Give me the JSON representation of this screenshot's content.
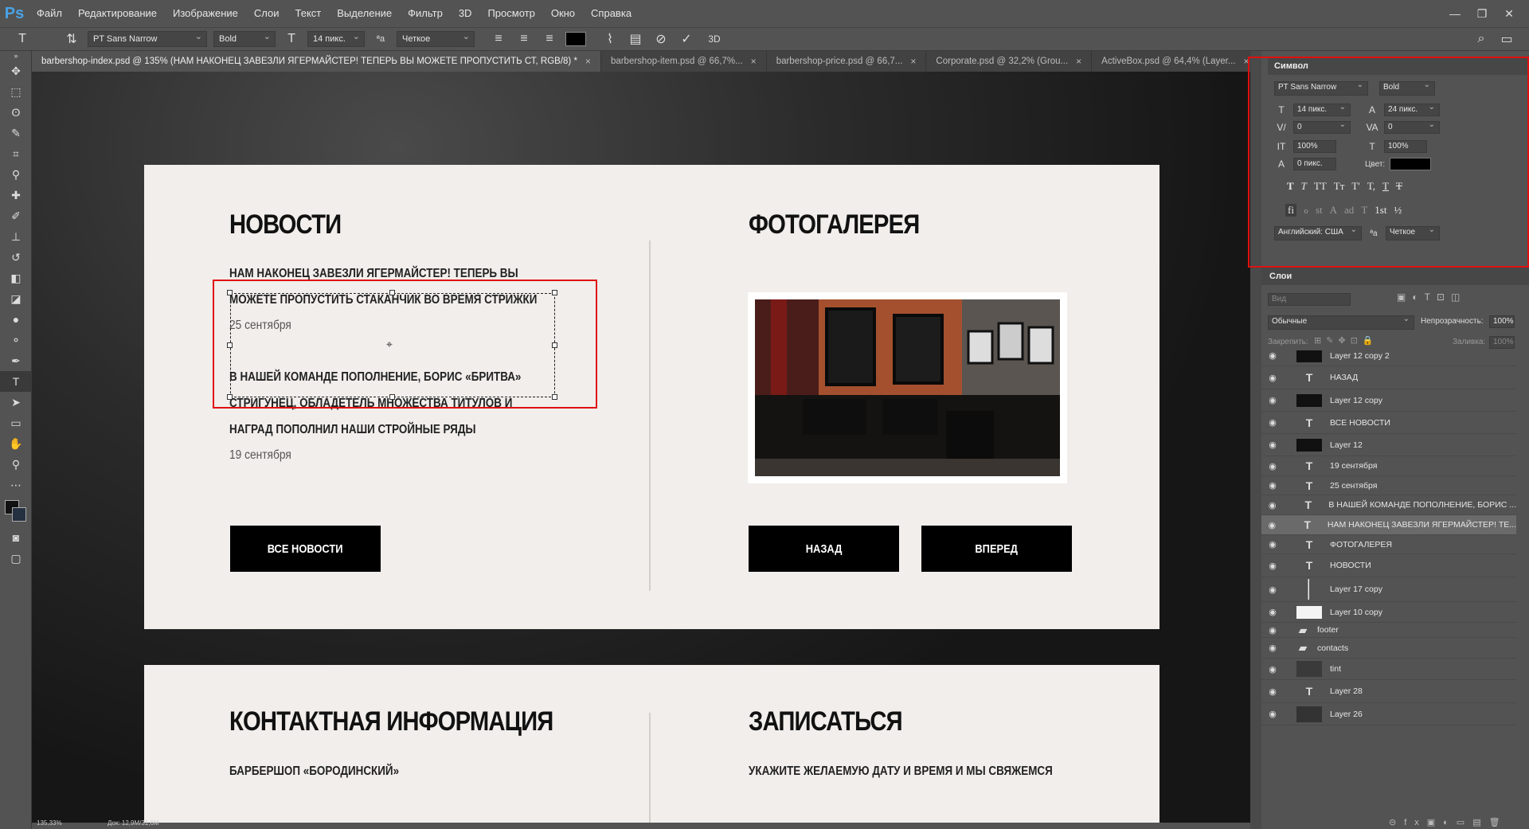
{
  "app": {
    "logo": "Ps"
  },
  "menu": [
    "Файл",
    "Редактирование",
    "Изображение",
    "Слои",
    "Текст",
    "Выделение",
    "Фильтр",
    "3D",
    "Просмотр",
    "Окно",
    "Справка"
  ],
  "window_controls": [
    "—",
    "❐",
    "✕"
  ],
  "options": {
    "font_family": "PT Sans Narrow",
    "font_style": "Bold",
    "font_size": "14 пикс.",
    "aa_label": "ªa",
    "antialias": "Четкое",
    "threed": "3D"
  },
  "tabs": [
    {
      "label": "barbershop-index.psd @ 135% (НАМ НАКОНЕЦ ЗАВЕЗЛИ ЯГЕРМАЙСТЕР! ТЕПЕРЬ ВЫ МОЖЕТЕ ПРОПУСТИТЬ СТ, RGB/8) *",
      "close": "×"
    },
    {
      "label": "barbershop-item.psd @ 66,7%...",
      "close": "×"
    },
    {
      "label": "barbershop-price.psd @ 66,7...",
      "close": "×"
    },
    {
      "label": "Corporate.psd @ 32,2% (Grou...",
      "close": "×"
    },
    {
      "label": "ActiveBox.psd @ 64,4% (Layer...",
      "close": "×"
    }
  ],
  "doc": {
    "news_title": "НОВОСТИ",
    "news1_line1": "НАМ НАКОНЕЦ ЗАВЕЗЛИ ЯГЕРМАЙСТЕР! ТЕПЕРЬ ВЫ",
    "news1_line2": "МОЖЕТЕ ПРОПУСТИТЬ СТАКАНЧИК ВО ВРЕМЯ СТРИЖКИ",
    "news1_date": "25 сентября",
    "news2_line1": "В НАШЕЙ КОМАНДЕ ПОПОЛНЕНИЕ, БОРИС «БРИТВА»",
    "news2_line2": "СТРИГУНЕЦ, ОБЛАДЕТЕЛЬ МНОЖЕСТВА ТИТУЛОВ И",
    "news2_line3": "НАГРАД ПОПОЛНИЛ НАШИ СТРОЙНЫЕ РЯДЫ",
    "news2_date": "19 сентября",
    "all_news_btn": "ВСЕ НОВОСТИ",
    "gallery_title": "ФОТОГАЛЕРЕЯ",
    "back_btn": "НАЗАД",
    "next_btn": "ВПЕРЕД",
    "contacts_title": "КОНТАКТНАЯ ИНФОРМАЦИЯ",
    "signup_title": "ЗАПИСАТЬСЯ",
    "contacts_line": "БАРБЕРШОП «БОРОДИНСКИЙ»",
    "signup_line": "УКАЖИТЕ ЖЕЛАЕМУЮ ДАТУ И ВРЕМЯ И МЫ СВЯЖЕМСЯ"
  },
  "char_panel": {
    "title": "Символ",
    "font": "PT Sans Narrow",
    "style": "Bold",
    "size": "14 пикс.",
    "leading": "24 пикс.",
    "kerning": "0",
    "tracking": "0",
    "vscale": "100%",
    "hscale": "100%",
    "baseline": "0 пикс.",
    "color_label": "Цвет:",
    "language": "Английский: США",
    "aa_label": "ªa",
    "antialias": "Четкое",
    "style_buttons": [
      "T",
      "T",
      "TT",
      "Tт",
      "T'",
      "T,",
      "T",
      "T"
    ],
    "ot_buttons": [
      "fi",
      "ℴ",
      "st",
      "A",
      "ad",
      "T",
      "1st",
      "½"
    ]
  },
  "layers_panel": {
    "title": "Слои",
    "search_placeholder": "Вид",
    "blend": "Обычные",
    "opacity_label": "Непрозрачность:",
    "opacity": "100%",
    "lock_label": "Закрепить:",
    "fill_label": "Заливка:",
    "fill": "100%",
    "layers": [
      {
        "name": "Layer 12 copy 2",
        "type": "pixel"
      },
      {
        "name": "НАЗАД",
        "type": "text"
      },
      {
        "name": "Layer 12 copy",
        "type": "pixel"
      },
      {
        "name": "ВСЕ НОВОСТИ",
        "type": "text"
      },
      {
        "name": "Layer 12",
        "type": "pixel"
      },
      {
        "name": "19 сентября",
        "type": "text"
      },
      {
        "name": "25 сентября",
        "type": "text"
      },
      {
        "name": "В НАШЕЙ КОМАНДЕ ПОПОЛНЕНИЕ, БОРИС ...",
        "type": "text"
      },
      {
        "name": "НАМ НАКОНЕЦ ЗАВЕЗЛИ ЯГЕРМАЙСТЕР! ТЕ...",
        "type": "text",
        "selected": true
      },
      {
        "name": "ФОТОГАЛЕРЕЯ",
        "type": "text"
      },
      {
        "name": "НОВОСТИ",
        "type": "text"
      },
      {
        "name": "Layer 17 copy",
        "type": "line"
      },
      {
        "name": "Layer 10 copy",
        "type": "white"
      },
      {
        "name": "footer",
        "type": "folder"
      },
      {
        "name": "contacts",
        "type": "folder"
      },
      {
        "name": "tint",
        "type": "photo"
      },
      {
        "name": "Layer 28",
        "type": "text"
      },
      {
        "name": "Layer 26",
        "type": "dark"
      }
    ]
  },
  "status": {
    "zoom": "135,33%",
    "doc": "Док: 12,9M/31,6M"
  },
  "colors": {
    "accent_red": "#e01010",
    "card_bg": "#f1eeeb",
    "ui_bg": "#535353"
  }
}
